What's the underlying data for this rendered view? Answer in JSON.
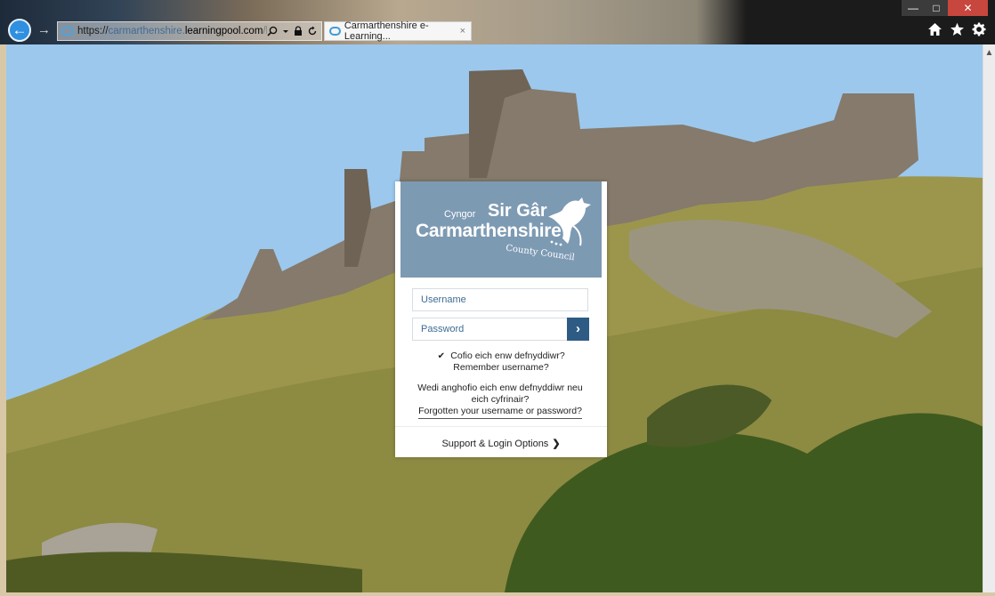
{
  "browser": {
    "url_prefix": "https://",
    "url_host1": "carmarthenshire.",
    "url_host": "learningpool.com",
    "url_suffix": "/logir",
    "tab_title": "Carmarthenshire e-Learning...",
    "tab_close": "×",
    "back_glyph": "←",
    "forward_glyph": "→",
    "address_icons": [
      "search-icon",
      "dropdown-icon",
      "lock-icon",
      "refresh-icon"
    ],
    "window_controls": [
      "minimize",
      "maximize",
      "close"
    ],
    "toolbar_icons": [
      "home-icon",
      "favorites-star-icon",
      "settings-gear-icon"
    ]
  },
  "logo": {
    "cyngor": "Cyngor",
    "sir_gar": "Sir Gâr",
    "carmarthenshire": "Carmarthenshire",
    "county_council": "County Council"
  },
  "login": {
    "username_placeholder": "Username",
    "password_placeholder": "Password",
    "submit_glyph": "›",
    "remember_checked": true,
    "remember_cy": "Cofio eich enw defnyddiwr?",
    "remember_en": "Remember username?",
    "forgot_cy": "Wedi anghofio eich enw defnyddiwr neu eich cyfrinair?",
    "forgot_en": "Forgotten your username or password?",
    "support_label": "Support & Login Options"
  },
  "colors": {
    "logo_band": "#7d9ab3",
    "submit_button": "#2e5b84",
    "field_text": "#3d6c95"
  }
}
